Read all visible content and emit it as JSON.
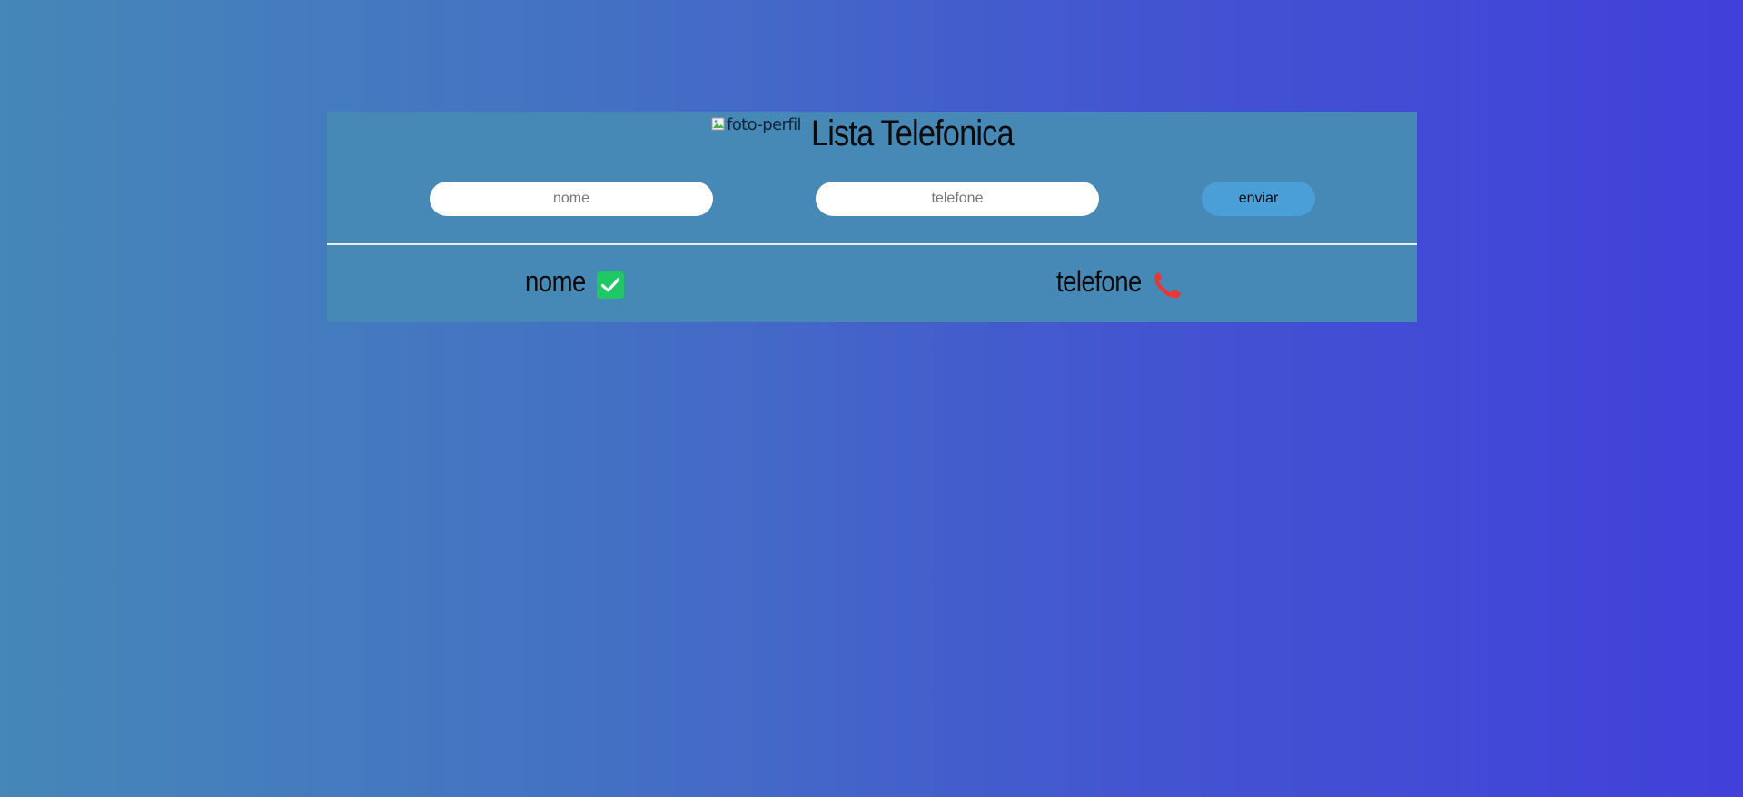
{
  "header": {
    "image_alt": "foto-perfil",
    "title": "Lista Telefonica"
  },
  "form": {
    "name_placeholder": "nome",
    "phone_placeholder": "telefone",
    "submit_label": "enviar"
  },
  "table": {
    "columns": [
      {
        "label": "nome",
        "icon": "check-icon"
      },
      {
        "label": "telefone",
        "icon": "phone-icon"
      }
    ]
  },
  "colors": {
    "card": "#4689b7",
    "button": "#4a9fd6",
    "check": "#1fc765",
    "phone": "#e53935"
  }
}
